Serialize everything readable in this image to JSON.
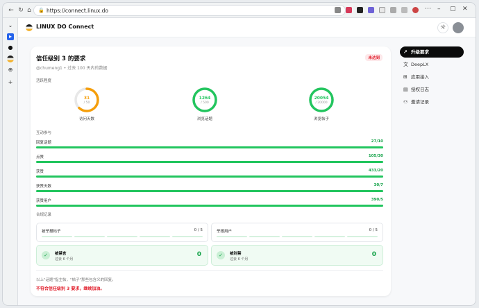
{
  "browser": {
    "url": "https://connect.linux.do"
  },
  "app": {
    "brand": "LINUX DO Connect"
  },
  "main": {
    "title": "信任级别 3 的要求",
    "badge": "未达到",
    "subtitle": "@chumeng1 • 过去 100 天内的数据",
    "section_activity": "活跃程度",
    "rings": [
      {
        "value": "31",
        "target": "/ 50",
        "label": "访问天数",
        "ratio": 0.62,
        "color": "#f59e0b"
      },
      {
        "value": "1264",
        "target": "/ 500",
        "label": "浏览话题",
        "ratio": 1.0,
        "color": "#22c55e"
      },
      {
        "value": "20054",
        "target": "/ 20000",
        "label": "浏览帖子",
        "ratio": 1.0,
        "color": "#22c55e"
      }
    ],
    "section_interaction": "互动参与",
    "bars": [
      {
        "label": "回复话题",
        "value": "27/10",
        "ratio": 1.0
      },
      {
        "label": "点赞",
        "value": "105/30",
        "ratio": 1.0
      },
      {
        "label": "获赞",
        "value": "433/20",
        "ratio": 1.0
      },
      {
        "label": "获赞天数",
        "value": "30/7",
        "ratio": 1.0
      },
      {
        "label": "获赞用户",
        "value": "390/5",
        "ratio": 1.0
      }
    ],
    "section_compliance": "合规记录",
    "violations": [
      {
        "label": "被举报帖子",
        "count": "0 / 5"
      },
      {
        "label": "举报用户",
        "count": "0 / 5"
      }
    ],
    "bans": [
      {
        "title": "被禁言",
        "sub": "过去 6 个月",
        "num": "0"
      },
      {
        "title": "被封禁",
        "sub": "过去 6 个月",
        "num": "0"
      }
    ],
    "footnote": "以上\"话题\"指主帖，\"帖子\"那些包含义的回复。",
    "result": "不符合信任级别 3 要求，继续加油。"
  },
  "rightnav": [
    {
      "label": "升级要求",
      "icon": "trend-up-icon",
      "glyph": "↗"
    },
    {
      "label": "DeepLX",
      "icon": "translate-icon",
      "glyph": "文"
    },
    {
      "label": "应用接入",
      "icon": "apps-icon",
      "glyph": "⊞"
    },
    {
      "label": "授权日志",
      "icon": "log-icon",
      "glyph": "▤"
    },
    {
      "label": "邀请记录",
      "icon": "users-icon",
      "glyph": "⚇"
    }
  ]
}
